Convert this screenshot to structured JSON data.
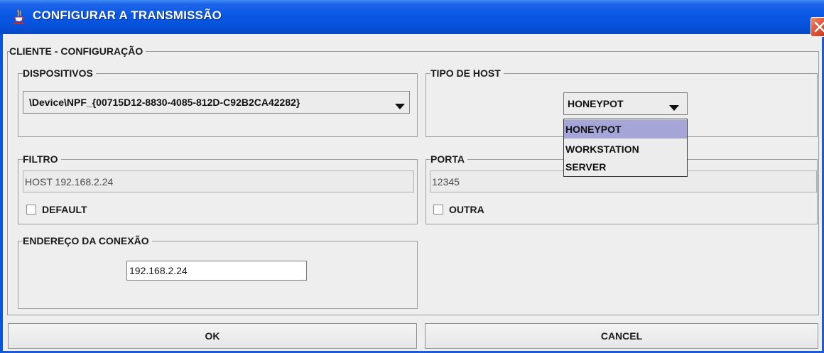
{
  "window": {
    "title": "CONFIGURAR A TRANSMISSÃO",
    "title_icon": "java-cup-icon",
    "close_icon": "close-icon"
  },
  "client_group": {
    "label": "CLIENTE - CONFIGURAÇÃO"
  },
  "dispositivos": {
    "label": "DISPOSITIVOS",
    "selected_value": "\\Device\\NPF_{00715D12-8830-4085-812D-C92B2CA42282}"
  },
  "tipo_de_host": {
    "label": "TIPO DE HOST",
    "selected_value": "HONEYPOT",
    "options": [
      "HONEYPOT",
      "WORKSTATION",
      "SERVER"
    ],
    "highlighted_option": "HONEYPOT"
  },
  "filtro": {
    "label": "FILTRO",
    "value": "HOST 192.168.2.24",
    "checkbox_label": "DEFAULT",
    "checkbox_checked": false
  },
  "porta": {
    "label": "PORTA",
    "value": "12345",
    "checkbox_label": "OUTRA",
    "checkbox_checked": false
  },
  "endereco": {
    "label": "ENDEREÇO DA CONEXÃO",
    "value": "192.168.2.24"
  },
  "buttons": {
    "ok_label": "OK",
    "cancel_label": "CANCEL"
  },
  "colors": {
    "titlebar": "#0958e5",
    "close_button": "#e0563a",
    "selected_option": "#a5a5d8",
    "window_bg": "#eeeeee"
  }
}
